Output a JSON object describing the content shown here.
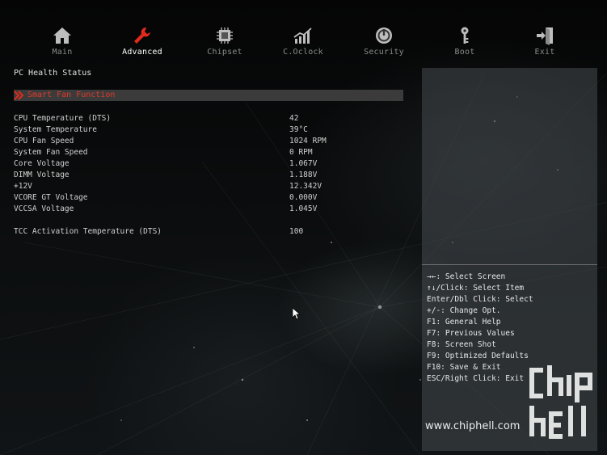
{
  "nav": {
    "items": [
      {
        "label": "Main",
        "icon": "home-icon"
      },
      {
        "label": "Advanced",
        "icon": "wrench-icon"
      },
      {
        "label": "Chipset",
        "icon": "chip-icon"
      },
      {
        "label": "C.Oclock",
        "icon": "chart-icon"
      },
      {
        "label": "Security",
        "icon": "shield-icon"
      },
      {
        "label": "Boot",
        "icon": "key-icon"
      },
      {
        "label": "Exit",
        "icon": "exit-icon"
      }
    ],
    "active_index": 1,
    "accent_color": "#e02a1a"
  },
  "main": {
    "section_title": "PC Health Status",
    "submenu_label": "Smart Fan Function",
    "readings": [
      {
        "name": "CPU Temperature (DTS)",
        "value": "42"
      },
      {
        "name": "System Temperature",
        "value": "39°C"
      },
      {
        "name": "CPU Fan Speed",
        "value": "1024 RPM"
      },
      {
        "name": "System Fan Speed",
        "value": "0 RPM"
      },
      {
        "name": "Core Voltage",
        "value": "1.067V"
      },
      {
        "name": "DIMM Voltage",
        "value": "1.188V"
      },
      {
        "name": "+12V",
        "value": "12.342V"
      },
      {
        "name": "VCORE GT Voltage",
        "value": "0.000V"
      },
      {
        "name": "VCCSA Voltage",
        "value": "1.045V"
      }
    ],
    "tcc": {
      "name": "TCC Activation Temperature (DTS)",
      "value": "100"
    }
  },
  "help": [
    "→←: Select Screen",
    "↑↓/Click: Select Item",
    "Enter/Dbl Click: Select",
    "+/-: Change Opt.",
    "F1: General Help",
    "F7: Previous Values",
    "F8: Screen Shot",
    "F9: Optimized Defaults",
    "F10: Save & Exit",
    "ESC/Right Click: Exit"
  ],
  "watermark": {
    "url": "www.chiphell.com",
    "logo_text": "chip hell"
  }
}
